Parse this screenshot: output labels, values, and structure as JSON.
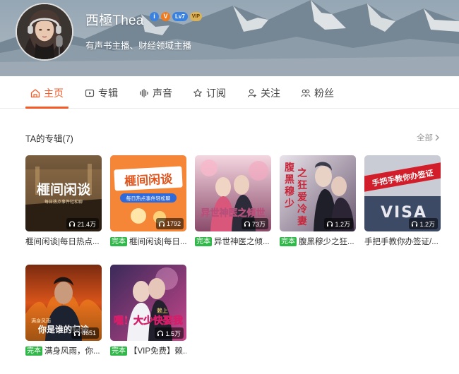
{
  "profile": {
    "name": "西極Thea",
    "description": "有声书主播、财经领域主播",
    "badges": {
      "round1": "i",
      "round2": "V",
      "level": "Lv7",
      "vip": "VIP"
    }
  },
  "tabs": [
    {
      "label": "主页",
      "icon": "home-icon",
      "active": true
    },
    {
      "label": "专辑",
      "icon": "album-icon",
      "active": false
    },
    {
      "label": "声音",
      "icon": "waveform-icon",
      "active": false
    },
    {
      "label": "订阅",
      "icon": "star-icon",
      "active": false
    },
    {
      "label": "关注",
      "icon": "user-follow-icon",
      "active": false
    },
    {
      "label": "粉丝",
      "icon": "fans-icon",
      "active": false
    }
  ],
  "section": {
    "title": "TA的专辑(7)",
    "see_all": "全部"
  },
  "albums": [
    {
      "title": "榧间闲谈|每日热点...",
      "tag": "",
      "plays": "21.4万",
      "cover_text": "榧间闲谈",
      "cover_sub": "每日热点事件轻松聊"
    },
    {
      "title": "榧间闲谈|每日...",
      "tag": "完本",
      "plays": "1792",
      "cover_text": "榧间闲谈",
      "cover_sub": "每日热点事件轻松聊"
    },
    {
      "title": "异世神医之倾...",
      "tag": "完本",
      "plays": "73万",
      "cover_text": "异世神医之倾世",
      "cover_sub": ""
    },
    {
      "title": "腹黑穆少之狂...",
      "tag": "完本",
      "plays": "1.2万",
      "cover_text": "腹黑穆少之狂爱冷妻",
      "cover_sub": ""
    },
    {
      "title": "手把手教你办签证/...",
      "tag": "",
      "plays": "1.2万",
      "cover_text": "手把手教你办签证",
      "cover_sub": "VISA"
    },
    {
      "title": "满身风雨，你...",
      "tag": "完本",
      "plays": "4651",
      "cover_text": "你是谁的归途",
      "cover_sub": "满身风雨"
    },
    {
      "title": "【VIP免费】赖...",
      "tag": "完本",
      "plays": "1.5万",
      "cover_text": "嘿！大少快娶我",
      "cover_sub": "赖上"
    }
  ],
  "colors": {
    "accent": "#f35a28",
    "finished_tag": "#32b84a"
  }
}
